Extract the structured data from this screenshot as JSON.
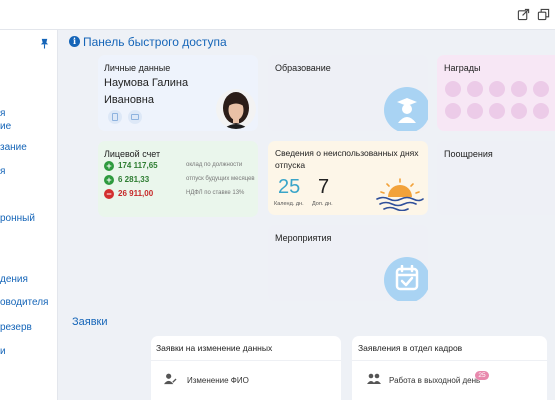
{
  "sidebar": {
    "items": [
      "я",
      "ие",
      "зание",
      "я",
      "ронный",
      "дения",
      "оводителя",
      "резерв",
      "и"
    ]
  },
  "dashboard": {
    "title": "Панель быстрого доступа"
  },
  "cards": {
    "personal": {
      "title": "Личные данные",
      "name_line1": "Наумова Галина",
      "name_line2": "Ивановна"
    },
    "education": {
      "title": "Образование"
    },
    "awards": {
      "title": "Награды"
    },
    "account": {
      "title": "Лицевой счет",
      "rows": [
        {
          "sign": "+",
          "amount": "174 117,65",
          "note": "оклад по должности",
          "color": "#2e9a3e"
        },
        {
          "sign": "+",
          "amount": "6 281,33",
          "note": "отпуск будущих месяцев",
          "color": "#2e9a3e"
        },
        {
          "sign": "−",
          "amount": "26 911,00",
          "note": "НДФЛ по ставке 13%",
          "color": "#d32f2f"
        }
      ]
    },
    "vacation": {
      "title_line1": "Сведения о неиспользованных днях",
      "title_line2": "отпуска",
      "calendar_days": "25",
      "calendar_label": "Календ. дн.",
      "extra_days": "7",
      "extra_label": "Доп. дн."
    },
    "encouragements": {
      "title": "Поощрения"
    },
    "events": {
      "title": "Мероприятия"
    }
  },
  "requests": {
    "title": "Заявки",
    "change_data": {
      "title": "Заявки на изменение данных",
      "item": "Изменение ФИО"
    },
    "hr_dept": {
      "title": "Заявления в отдел кадров",
      "item": "Работа в выходной день",
      "badge": "25"
    }
  },
  "colors": {
    "accent": "#1565b8",
    "personal_bg": "#eef3fc",
    "account_bg": "#eaf6ec",
    "vacation_bg": "#fdf6e8",
    "awards_bg": "#f7e7f5",
    "neutral_bg": "#eef0f6",
    "badge": "#e889ad"
  },
  "icons": {
    "topbar": [
      "export-icon",
      "restore-window-icon"
    ],
    "sidebar_pin": "pin-icon",
    "info": "info-icon",
    "education": "graduate-icon",
    "events": "calendar-check-icon",
    "vacation": "sunset-icon",
    "change_data": "user-edit-icon",
    "hr_dept": "user-group-icon"
  }
}
